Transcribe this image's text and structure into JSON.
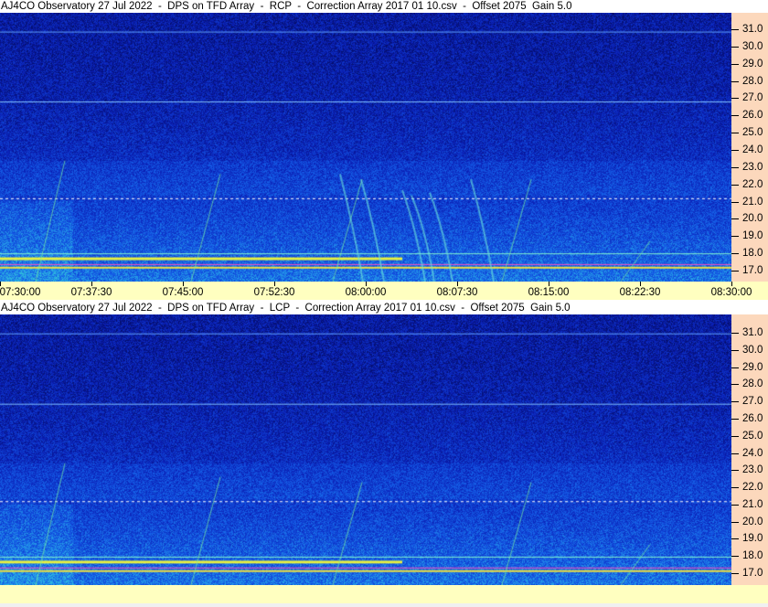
{
  "panels": [
    {
      "title": "AJ4CO Observatory 27 Jul 2022  -  DPS on TFD Array  -  RCP  -  Correction Array 2017 01 10.csv  -  Offset 2075  Gain 5.0",
      "polarization": "RCP"
    },
    {
      "title": "AJ4CO Observatory 27 Jul 2022  -  DPS on TFD Array  -  LCP  -  Correction Array 2017 01 10.csv  -  Offset 2075  Gain 5.0",
      "polarization": "LCP"
    }
  ],
  "freq_labels": [
    "31.0",
    "30.0",
    "29.0",
    "28.0",
    "27.0",
    "26.0",
    "25.0",
    "24.0",
    "23.0",
    "22.0",
    "21.0",
    "20.0",
    "19.0",
    "18.0",
    "17.0"
  ],
  "time_labels": [
    "07:30:00",
    "07:37:30",
    "07:45:00",
    "07:52:30",
    "08:00:00",
    "08:07:30",
    "08:15:00",
    "08:22:30",
    "08:30:00"
  ],
  "colors": {
    "axis_bg": "#fcd8bc",
    "time_axis_bg": "#ffffc0"
  }
}
